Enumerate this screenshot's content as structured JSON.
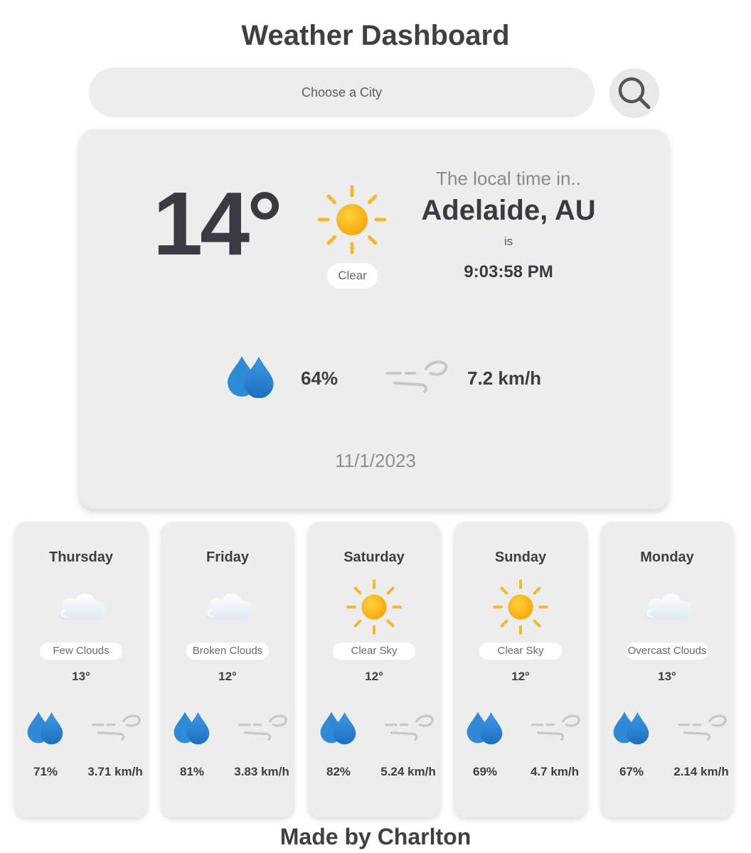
{
  "header": {
    "title": "Weather Dashboard"
  },
  "search": {
    "placeholder": "Choose a City",
    "button_icon": "search-icon"
  },
  "current": {
    "temperature": "14°",
    "icon": "sun-icon",
    "condition": "Clear",
    "local_time_label": "The local time in..",
    "city": "Adelaide, AU",
    "is_label": "is",
    "time": "9:03:58 PM",
    "humidity": "64%",
    "humidity_icon": "water-drops-icon",
    "wind_speed": "7.2 km/h",
    "wind_icon": "wind-icon",
    "date": "11/1/2023"
  },
  "forecast": [
    {
      "day": "Thursday",
      "icon": "cloud-icon",
      "condition": "Few Clouds",
      "temperature": "13°",
      "humidity": "71%",
      "wind": "3.71 km/h"
    },
    {
      "day": "Friday",
      "icon": "cloud-icon",
      "condition": "Broken Clouds",
      "temperature": "12°",
      "humidity": "81%",
      "wind": "3.83 km/h"
    },
    {
      "day": "Saturday",
      "icon": "sun-icon",
      "condition": "Clear Sky",
      "temperature": "12°",
      "humidity": "82%",
      "wind": "5.24 km/h"
    },
    {
      "day": "Sunday",
      "icon": "sun-icon",
      "condition": "Clear Sky",
      "temperature": "12°",
      "humidity": "69%",
      "wind": "4.7 km/h"
    },
    {
      "day": "Monday",
      "icon": "cloud-icon",
      "condition": "Overcast Clouds",
      "temperature": "13°",
      "humidity": "67%",
      "wind": "2.14 km/h"
    }
  ],
  "footer": {
    "text": "Made by Charlton"
  },
  "colors": {
    "sun": "#fbb118",
    "sun_ray": "#f8b62b",
    "drop": "#2f8ad8",
    "wind": "#c9c9cc",
    "card_bg": "#ededed",
    "text_dark": "#3d3d45"
  }
}
